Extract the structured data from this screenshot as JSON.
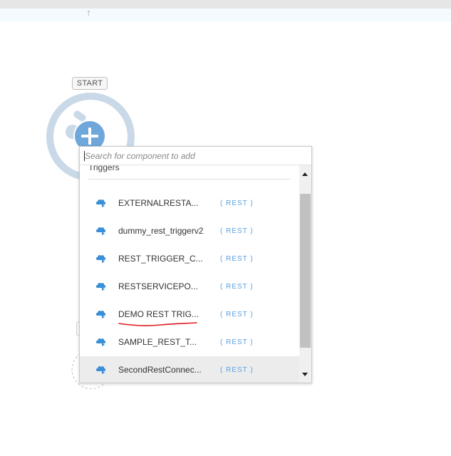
{
  "canvas": {
    "start_label": "START"
  },
  "picker": {
    "search_placeholder": "Search for component to add",
    "group_label": "Triggers",
    "items": [
      {
        "name": "EXTERNALRESTA...",
        "type": "( REST )",
        "icon": "cloud-trigger-icon"
      },
      {
        "name": "dummy_rest_triggerv2",
        "type": "( REST )",
        "icon": "cloud-trigger-icon"
      },
      {
        "name": "REST_TRIGGER_C...",
        "type": "( REST )",
        "icon": "cloud-trigger-icon"
      },
      {
        "name": "RESTSERVICEPO...",
        "type": "( REST )",
        "icon": "cloud-trigger-icon"
      },
      {
        "name": "DEMO REST TRIG...",
        "type": "( REST )",
        "icon": "cloud-trigger-icon"
      },
      {
        "name": "SAMPLE_REST_T...",
        "type": "( REST )",
        "icon": "cloud-trigger-icon"
      },
      {
        "name": "SecondRestConnec...",
        "type": "( REST )",
        "icon": "cloud-trigger-icon",
        "selected": true
      }
    ]
  },
  "colors": {
    "accent_blue": "#5aa0e0",
    "add_button": "#6fa7db",
    "ring": "#c9d9e8",
    "annotation_underline": "#e0191e",
    "selected_row": "#ececec"
  }
}
